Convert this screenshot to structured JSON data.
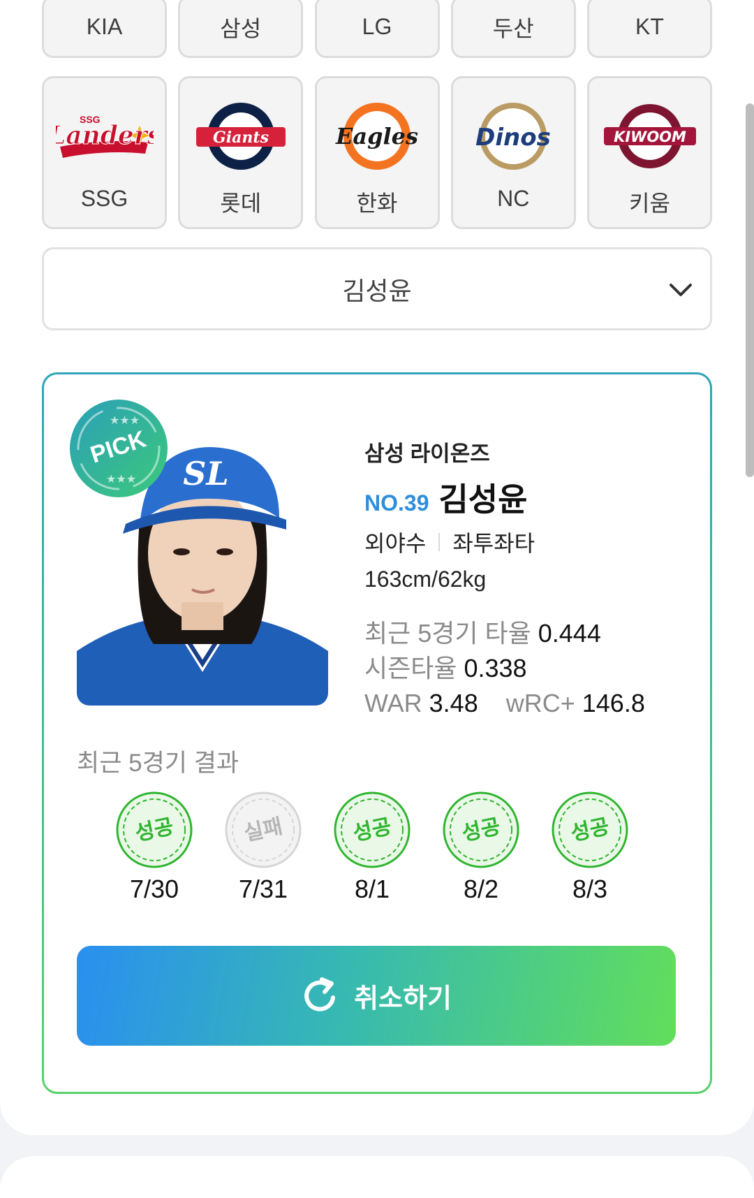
{
  "teams": [
    {
      "name": "KIA"
    },
    {
      "name": "삼성"
    },
    {
      "name": "LG"
    },
    {
      "name": "두산"
    },
    {
      "name": "KT"
    },
    {
      "name": "SSG",
      "logo_text": "Landers"
    },
    {
      "name": "롯데",
      "logo_text": "Giants"
    },
    {
      "name": "한화",
      "logo_text": "Eagles"
    },
    {
      "name": "NC",
      "logo_text": "Dinos"
    },
    {
      "name": "키움",
      "logo_text": "KIWOOM"
    }
  ],
  "player_select": {
    "value": "김성윤",
    "icon": "chevron-down-icon"
  },
  "card": {
    "badge": "PICK",
    "team": "삼성 라이온즈",
    "number": "NO.39",
    "name": "김성윤",
    "position": "외야수",
    "bats_throws": "좌투좌타",
    "body": "163cm/62kg",
    "stats": {
      "recent5_label": "최근 5경기 타율",
      "recent5_value": "0.444",
      "season_label": "시즌타율",
      "season_value": "0.338",
      "war_label": "WAR",
      "war_value": "3.48",
      "wrc_label": "wRC+",
      "wrc_value": "146.8"
    },
    "recent_title": "최근 5경기 결과",
    "results": [
      {
        "result": "성공",
        "date": "7/30",
        "success": true
      },
      {
        "result": "실패",
        "date": "7/31",
        "success": false
      },
      {
        "result": "성공",
        "date": "8/1",
        "success": true
      },
      {
        "result": "성공",
        "date": "8/2",
        "success": true
      },
      {
        "result": "성공",
        "date": "8/3",
        "success": true
      }
    ],
    "cancel_label": "취소하기"
  },
  "colors": {
    "accent_blue": "#2f8edb",
    "success_green": "#2fb52f",
    "fail_gray": "#b5b5b5"
  }
}
